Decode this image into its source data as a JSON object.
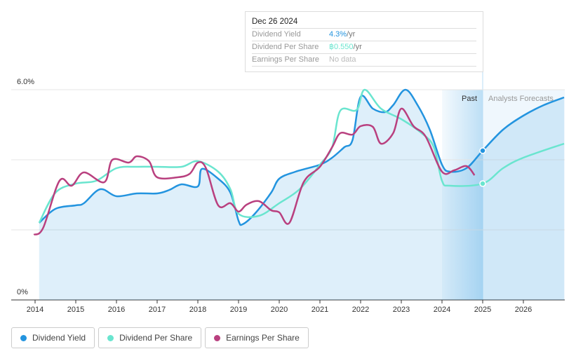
{
  "tooltip": {
    "date": "Dec 26 2024",
    "rows": [
      {
        "label": "Dividend Yield",
        "value": "4.3%",
        "unit": " /yr",
        "color": "#2394df"
      },
      {
        "label": "Dividend Per Share",
        "value": "฿0.550",
        "unit": " /yr",
        "color": "#6ae5cf"
      },
      {
        "label": "Earnings Per Share",
        "value": "No data",
        "unit": "",
        "color": "#bbbbbb"
      }
    ]
  },
  "legend": [
    {
      "label": "Dividend Yield",
      "color": "#2394df"
    },
    {
      "label": "Dividend Per Share",
      "color": "#6ae5cf"
    },
    {
      "label": "Earnings Per Share",
      "color": "#b9407f"
    }
  ],
  "chart_data": {
    "type": "line",
    "ylim": [
      0,
      6
    ],
    "xlim": [
      2013.7,
      2027
    ],
    "y_tick_labels": [
      "6.0%",
      "0%"
    ],
    "x_tick_labels": [
      "2014",
      "2015",
      "2016",
      "2017",
      "2018",
      "2019",
      "2020",
      "2021",
      "2022",
      "2023",
      "2024",
      "2025",
      "2026"
    ],
    "regions": {
      "past_label": "Past",
      "forecast_label": "Analysts Forecasts",
      "past_start": 2024,
      "forecast_start": 2025
    },
    "grid": true,
    "series": [
      {
        "name": "Dividend Yield",
        "color": "#2394df",
        "fill": true,
        "points": [
          [
            2014.1,
            2.2
          ],
          [
            2014.5,
            2.6
          ],
          [
            2015,
            2.7
          ],
          [
            2015.2,
            2.76
          ],
          [
            2015.6,
            3.16
          ],
          [
            2016,
            2.96
          ],
          [
            2016.5,
            3.04
          ],
          [
            2017,
            3.04
          ],
          [
            2017.3,
            3.14
          ],
          [
            2017.6,
            3.3
          ],
          [
            2018,
            3.24
          ],
          [
            2018.1,
            3.74
          ],
          [
            2018.5,
            3.46
          ],
          [
            2018.8,
            3.06
          ],
          [
            2019,
            2.26
          ],
          [
            2019.1,
            2.16
          ],
          [
            2019.4,
            2.46
          ],
          [
            2019.8,
            3.06
          ],
          [
            2020,
            3.46
          ],
          [
            2020.4,
            3.66
          ],
          [
            2021,
            3.86
          ],
          [
            2021.3,
            4.06
          ],
          [
            2021.6,
            4.36
          ],
          [
            2021.8,
            4.56
          ],
          [
            2022,
            5.8
          ],
          [
            2022.3,
            5.46
          ],
          [
            2022.6,
            5.36
          ],
          [
            2022.8,
            5.56
          ],
          [
            2023.1,
            6.0
          ],
          [
            2023.4,
            5.56
          ],
          [
            2023.7,
            4.86
          ],
          [
            2024,
            3.86
          ],
          [
            2024.2,
            3.66
          ],
          [
            2024.6,
            3.76
          ],
          [
            2025,
            4.26
          ],
          [
            2025.5,
            4.86
          ],
          [
            2026,
            5.26
          ],
          [
            2026.5,
            5.56
          ],
          [
            2027,
            5.78
          ]
        ]
      },
      {
        "name": "Dividend Per Share",
        "color": "#6ae5cf",
        "fill": false,
        "points": [
          [
            2014.1,
            2.2
          ],
          [
            2014.5,
            3.06
          ],
          [
            2015,
            3.32
          ],
          [
            2015.5,
            3.4
          ],
          [
            2016,
            3.76
          ],
          [
            2016.5,
            3.8
          ],
          [
            2017,
            3.8
          ],
          [
            2017.6,
            3.8
          ],
          [
            2018,
            3.96
          ],
          [
            2018.5,
            3.66
          ],
          [
            2018.8,
            3.16
          ],
          [
            2019,
            2.46
          ],
          [
            2019.5,
            2.4
          ],
          [
            2020,
            2.76
          ],
          [
            2020.5,
            3.16
          ],
          [
            2021,
            3.86
          ],
          [
            2021.3,
            4.36
          ],
          [
            2021.5,
            5.4
          ],
          [
            2021.9,
            5.42
          ],
          [
            2022.1,
            6.0
          ],
          [
            2022.5,
            5.46
          ],
          [
            2023,
            5.16
          ],
          [
            2023.5,
            4.76
          ],
          [
            2023.8,
            4.36
          ],
          [
            2024,
            3.4
          ],
          [
            2024.2,
            3.26
          ],
          [
            2025,
            3.32
          ],
          [
            2025.5,
            3.76
          ],
          [
            2026,
            4.06
          ],
          [
            2027,
            4.46
          ]
        ]
      },
      {
        "name": "Earnings Per Share",
        "color": "#b9407f",
        "fill": false,
        "points": [
          [
            2013.97,
            1.86
          ],
          [
            2014.2,
            2.06
          ],
          [
            2014.6,
            3.4
          ],
          [
            2014.9,
            3.26
          ],
          [
            2015.2,
            3.64
          ],
          [
            2015.7,
            3.36
          ],
          [
            2015.9,
            4.0
          ],
          [
            2016.3,
            3.92
          ],
          [
            2016.5,
            4.1
          ],
          [
            2016.8,
            3.96
          ],
          [
            2017,
            3.5
          ],
          [
            2017.5,
            3.5
          ],
          [
            2017.8,
            3.6
          ],
          [
            2018,
            3.92
          ],
          [
            2018.2,
            3.76
          ],
          [
            2018.5,
            2.7
          ],
          [
            2018.8,
            2.76
          ],
          [
            2019,
            2.52
          ],
          [
            2019.2,
            2.72
          ],
          [
            2019.5,
            2.82
          ],
          [
            2019.8,
            2.56
          ],
          [
            2020,
            2.5
          ],
          [
            2020.25,
            2.2
          ],
          [
            2020.6,
            3.36
          ],
          [
            2021,
            3.8
          ],
          [
            2021.3,
            4.36
          ],
          [
            2021.5,
            4.76
          ],
          [
            2021.8,
            4.72
          ],
          [
            2022,
            4.96
          ],
          [
            2022.3,
            4.94
          ],
          [
            2022.5,
            4.46
          ],
          [
            2022.8,
            4.76
          ],
          [
            2023,
            5.46
          ],
          [
            2023.3,
            4.96
          ],
          [
            2023.6,
            4.66
          ],
          [
            2024,
            3.66
          ],
          [
            2024.3,
            3.7
          ],
          [
            2024.6,
            3.82
          ],
          [
            2024.8,
            3.56
          ]
        ]
      }
    ],
    "markers": [
      {
        "series": "Dividend Yield",
        "x": 2025,
        "y": 4.26
      },
      {
        "series": "Dividend Per Share",
        "x": 2025,
        "y": 3.32
      }
    ]
  }
}
